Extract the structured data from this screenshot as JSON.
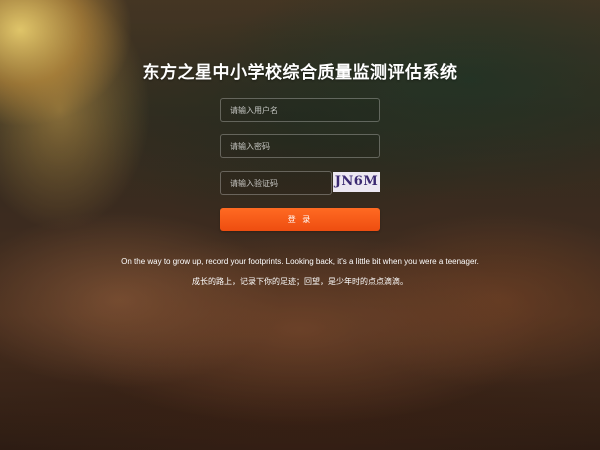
{
  "login": {
    "title": "东方之星中小学校综合质量监测评估系统",
    "username_placeholder": "请输入用户名",
    "password_placeholder": "请输入密码",
    "captcha_placeholder": "请输入验证码",
    "captcha_code": "JN6M",
    "submit_label": "登 录"
  },
  "slogan": {
    "english": "On the way to grow up, record your footprints. Looking back, it's a little bit when you were a teenager.",
    "chinese": "成长的路上，记录下你的足迹；回望，是少年时的点点滴滴。"
  },
  "colors": {
    "accent": "#ee4d10",
    "captcha_text": "#3b2a72"
  }
}
